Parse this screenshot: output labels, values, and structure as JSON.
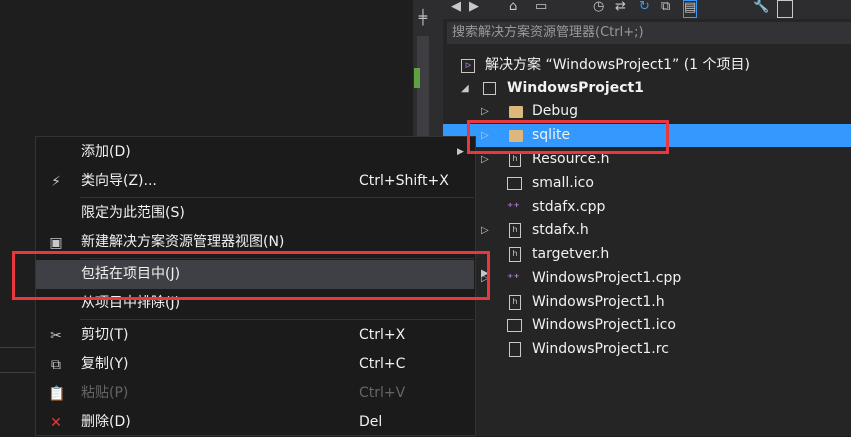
{
  "solution_explorer": {
    "search_placeholder": "搜索解决方案资源管理器(Ctrl+;)",
    "solution_label": "解决方案 “WindowsProject1” (1 个项目)",
    "project_label": "WindowsProject1",
    "items": [
      {
        "label": "Debug",
        "icon": "folder-icon"
      },
      {
        "label": "sqlite",
        "icon": "folder-icon"
      },
      {
        "label": "Resource.h",
        "icon": "header-file-icon"
      },
      {
        "label": "small.ico",
        "icon": "image-file-icon"
      },
      {
        "label": "stdafx.cpp",
        "icon": "cpp-file-icon"
      },
      {
        "label": "stdafx.h",
        "icon": "header-file-icon"
      },
      {
        "label": "targetver.h",
        "icon": "header-file-icon"
      },
      {
        "label": "WindowsProject1.cpp",
        "icon": "cpp-file-icon"
      },
      {
        "label": "WindowsProject1.h",
        "icon": "header-file-icon"
      },
      {
        "label": "WindowsProject1.ico",
        "icon": "image-file-icon"
      },
      {
        "label": "WindowsProject1.rc",
        "icon": "resource-file-icon"
      }
    ]
  },
  "context_menu": {
    "add": "添加(D)",
    "class_wizard": "类向导(Z)...",
    "class_wizard_shortcut": "Ctrl+Shift+X",
    "scope_to_this": "限定为此范围(S)",
    "new_view": "新建解决方案资源管理器视图(N)",
    "include_in_project": "包括在项目中(J)",
    "exclude_from_project": "从项目中排除(J)",
    "cut": "剪切(T)",
    "cut_shortcut": "Ctrl+X",
    "copy": "复制(Y)",
    "copy_shortcut": "Ctrl+C",
    "paste": "粘贴(P)",
    "paste_shortcut": "Ctrl+V",
    "delete": "删除(D)",
    "delete_shortcut": "Del"
  },
  "colors": {
    "selection": "#3399ff",
    "highlight_box": "#e8383d",
    "folder": "#dcb67a"
  }
}
